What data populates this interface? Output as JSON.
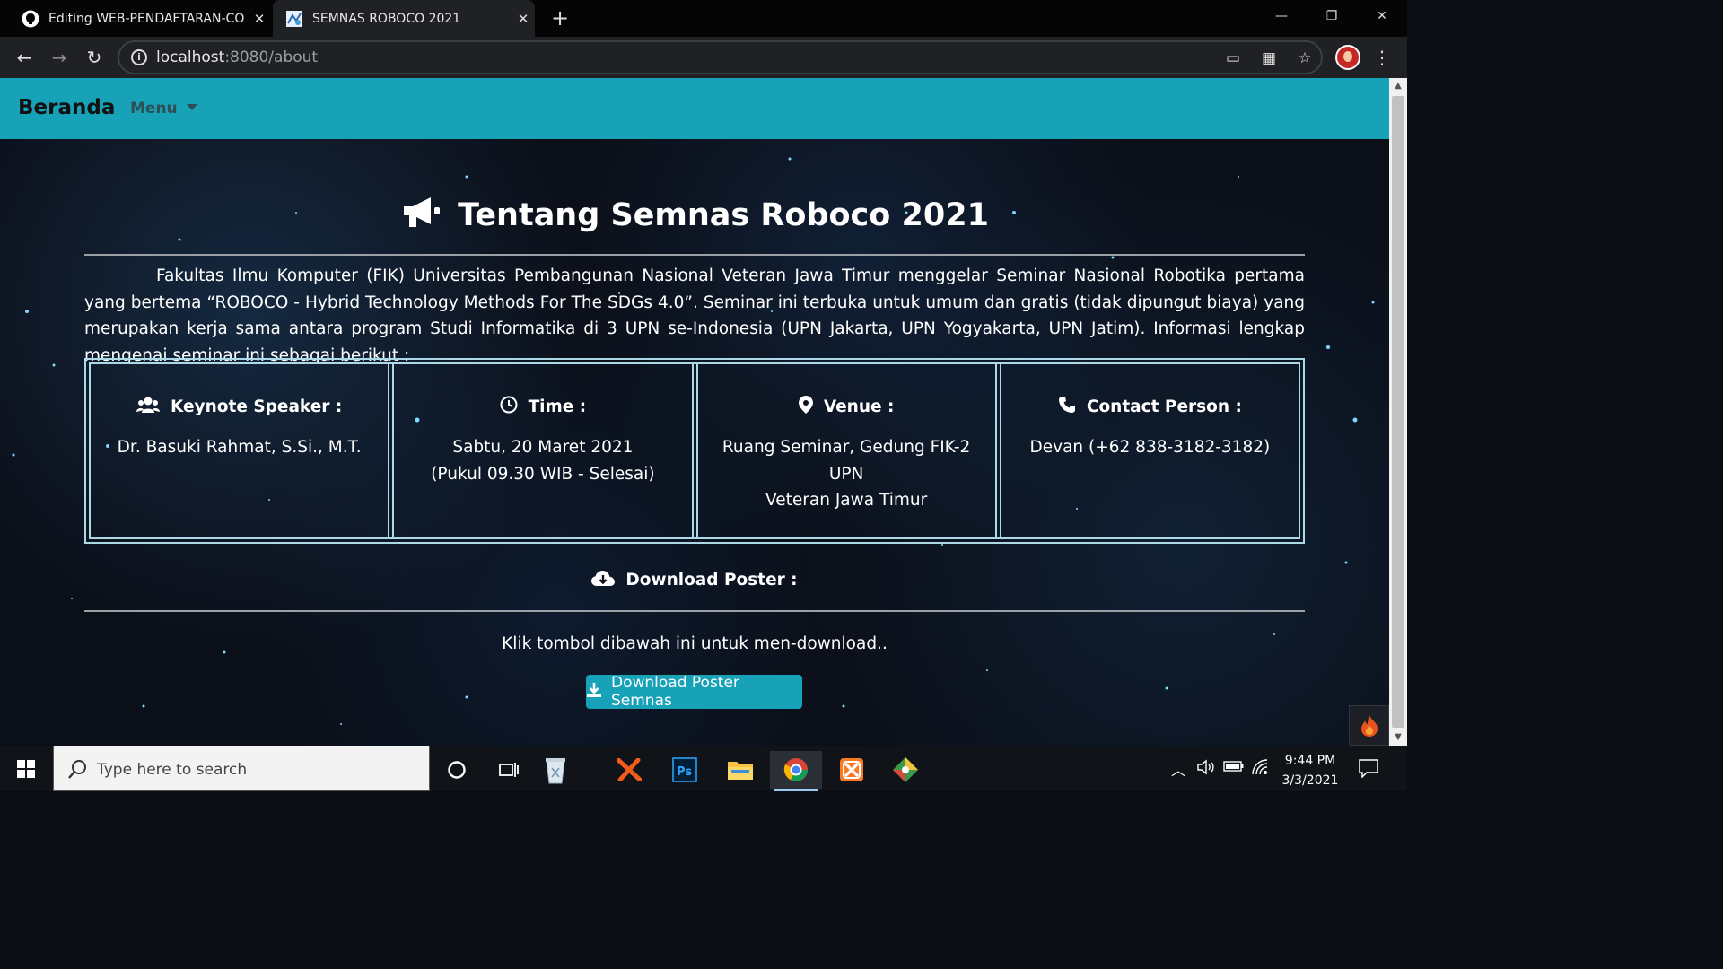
{
  "browser": {
    "tabs": [
      {
        "title": "Editing WEB-PENDAFTARAN-CO",
        "icon": "github-icon",
        "active": false
      },
      {
        "title": "SEMNAS ROBOCO 2021",
        "icon": "site-favicon",
        "active": true
      }
    ],
    "address": {
      "host": "localhost",
      "rest": ":8080/about"
    }
  },
  "navbar": {
    "brand": "Beranda",
    "menu": "Menu",
    "color": "#17a2b8"
  },
  "page": {
    "title": "Tentang Semnas Roboco 2021",
    "intro": "Fakultas Ilmu Komputer (FIK) Universitas Pembangunan Nasional Veteran Jawa Timur menggelar Seminar Nasional Robotika pertama yang bertema “ROBOCO - Hybrid Technology Methods For The SDGs 4.0”. Seminar ini terbuka untuk umum dan gratis (tidak dipungut biaya) yang merupakan kerja sama antara program Studi Informatika di 3 UPN se-Indonesia (UPN Jakarta, UPN Yogyakarta, UPN Jatim). Informasi lengkap mengenai seminar ini sebagai berikut :",
    "info": [
      {
        "icon": "users-icon",
        "label": "Keynote Speaker :",
        "lines": [
          "Dr. Basuki Rahmat, S.Si., M.T."
        ]
      },
      {
        "icon": "clock-icon",
        "label": "Time :",
        "lines": [
          "Sabtu, 20 Maret 2021",
          "(Pukul 09.30 WIB - Selesai)"
        ]
      },
      {
        "icon": "map-marker-icon",
        "label": "Venue :",
        "lines": [
          "Ruang Seminar, Gedung FIK-2 UPN",
          "Veteran Jawa Timur"
        ]
      },
      {
        "icon": "phone-icon",
        "label": "Contact Person :",
        "lines": [
          "Devan (+62 838-3182-3182)"
        ]
      }
    ],
    "download": {
      "title": "Download Poster :",
      "text": "Klik tombol dibawah ini untuk men-download..",
      "button": "Download Poster Semnas"
    }
  },
  "taskbar": {
    "search_placeholder": "Type here to search",
    "time": "9:44 PM",
    "date": "3/3/2021"
  }
}
